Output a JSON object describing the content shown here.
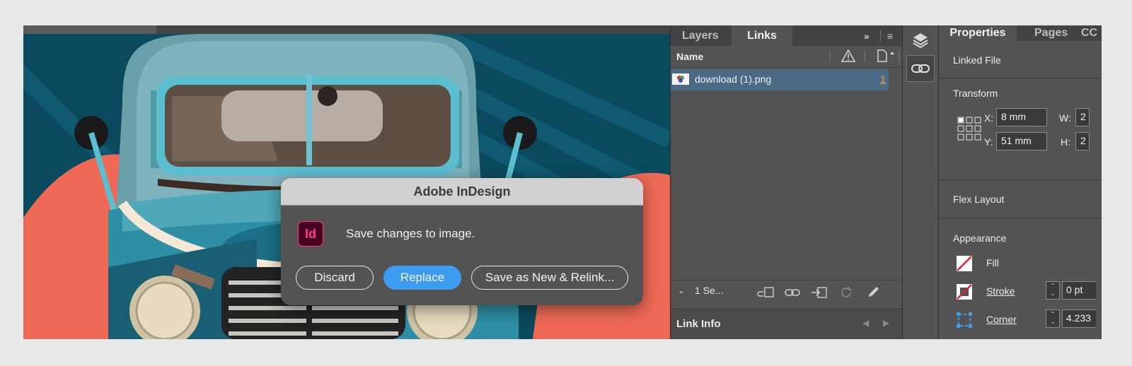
{
  "dialog": {
    "title": "Adobe InDesign",
    "app_icon_text": "Id",
    "message": "Save changes to image.",
    "buttons": {
      "discard": "Discard",
      "replace": "Replace",
      "save_new": "Save as New & Relink..."
    }
  },
  "links_panel": {
    "tabs": [
      "Layers",
      "Links"
    ],
    "active_tab": "Links",
    "expand_glyph": "»",
    "menu_glyph": "≡",
    "column_name": "Name",
    "links": [
      {
        "name": "download (1).png",
        "page": "1"
      }
    ],
    "selection_chevron": "⌄",
    "selection_count": "1 Se...",
    "link_info_title": "Link Info",
    "prev_glyph": "◀",
    "next_glyph": "▶"
  },
  "properties": {
    "tabs": [
      "Properties",
      "Pages",
      "CC"
    ],
    "active_tab": "Properties",
    "linked_file": "Linked File",
    "transform": {
      "title": "Transform",
      "x_label": "X:",
      "x_value": "8 mm",
      "y_label": "Y:",
      "y_value": "51 mm",
      "w_label": "W:",
      "w_value": "2",
      "h_label": "H:",
      "h_value": "2"
    },
    "flex_layout": "Flex Layout",
    "appearance": {
      "title": "Appearance",
      "fill": "Fill",
      "stroke": "Stroke",
      "stroke_value": "0 pt",
      "corner": "Corner",
      "corner_value": "4.233"
    }
  },
  "colors": {
    "accent": "#3d9bf0",
    "selection": "#4a6a86",
    "page_number": "#f0a336",
    "panel_bg": "#535353",
    "indesign_brand": "#ff3d8b"
  },
  "icons": {
    "strip": [
      "layers-icon",
      "links-icon"
    ],
    "links_toolbar": [
      "relink-cc-icon",
      "relink-icon",
      "go-to-link-icon",
      "update-link-icon",
      "edit-original-icon"
    ]
  }
}
